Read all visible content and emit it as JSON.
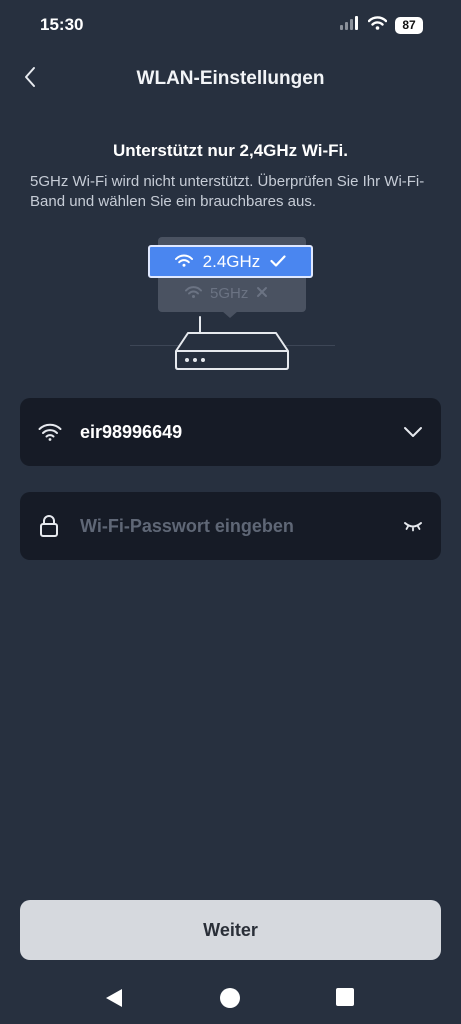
{
  "status_bar": {
    "time": "15:30",
    "battery": "87",
    "signal_icon": "signal-icon",
    "wifi_icon": "wifi-icon"
  },
  "header": {
    "title": "WLAN-Einstellungen",
    "back_icon": "chevron-left-icon"
  },
  "notice": {
    "headline": "Unterstützt nur 2,4GHz Wi-Fi.",
    "description": "5GHz Wi-Fi wird nicht unterstützt. Überprüfen Sie Ihr Wi-Fi-Band und wählen Sie ein brauchbares aus."
  },
  "illustration": {
    "band_supported": "2.4GHz",
    "band_unsupported": "5GHz"
  },
  "network_field": {
    "ssid": "eir98996649",
    "icon": "wifi-icon",
    "dropdown_icon": "chevron-down-icon"
  },
  "password_field": {
    "placeholder": "Wi-Fi-Passwort eingeben",
    "icon": "lock-icon",
    "toggle_icon": "eye-closed-icon"
  },
  "next_button": {
    "label": "Weiter"
  },
  "nav_bar": {
    "back": "triangle-back-icon",
    "home": "circle-home-icon",
    "recents": "square-recents-icon"
  },
  "colors": {
    "background": "#27303f",
    "field": "#161b26",
    "accent": "#4a86f0",
    "button": "#d6d9de"
  }
}
